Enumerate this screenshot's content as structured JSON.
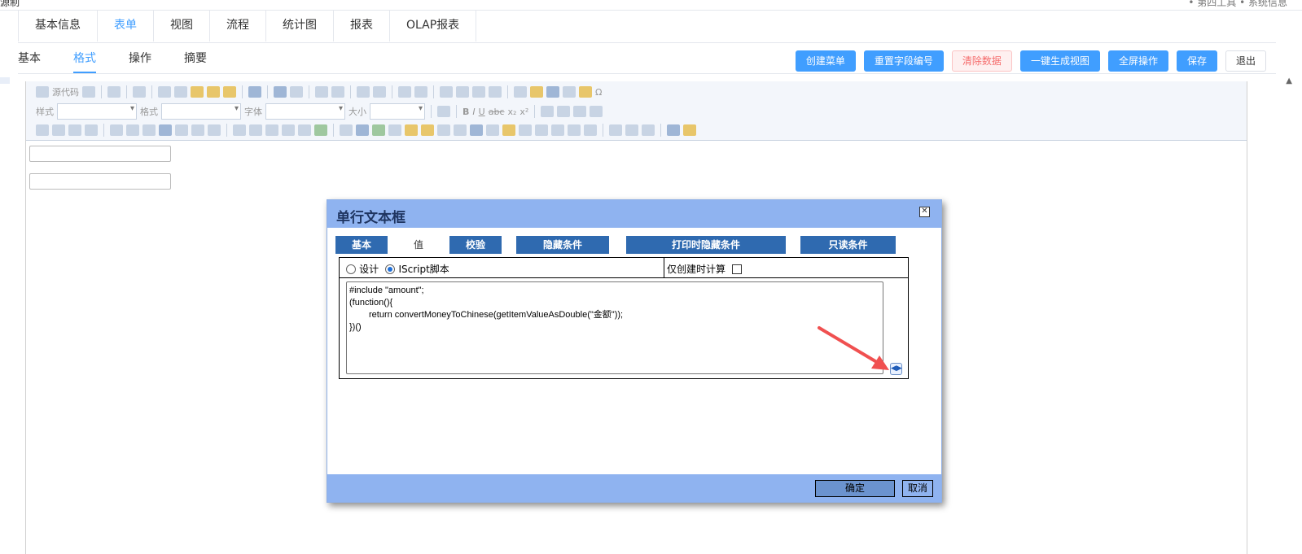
{
  "header": {
    "title_fragment": "源制",
    "right_fragment": "• 第四工具  • 系统信息"
  },
  "main_tabs": [
    {
      "label": "基本信息"
    },
    {
      "label": "表单"
    },
    {
      "label": "视图"
    },
    {
      "label": "流程"
    },
    {
      "label": "统计图"
    },
    {
      "label": "报表"
    },
    {
      "label": "OLAP报表"
    }
  ],
  "main_tab_active": "表单",
  "sub_tabs": [
    {
      "label": "基本"
    },
    {
      "label": "格式"
    },
    {
      "label": "操作"
    },
    {
      "label": "摘要"
    }
  ],
  "sub_tab_active": "格式",
  "actions": {
    "create_menu": "创建菜单",
    "reset_field_no": "重置字段编号",
    "clear_data": "清除数据",
    "gen_view": "一键生成视图",
    "fullscreen": "全屏操作",
    "save": "保存",
    "exit": "退出"
  },
  "toolbar": {
    "source": "源代码",
    "style": "样式",
    "format": "格式",
    "font": "字体",
    "size": "大小",
    "bold": "B",
    "italic": "I",
    "underline": "U",
    "strike": "abc",
    "subscript": "x₂",
    "superscript": "x²",
    "omega": "Ω"
  },
  "dialog": {
    "title": "单行文本框",
    "close": "✕",
    "tabs": [
      {
        "label": "基本"
      },
      {
        "label": "值"
      },
      {
        "label": "校验"
      },
      {
        "label": "隐藏条件"
      },
      {
        "label": "打印时隐藏条件"
      },
      {
        "label": "只读条件"
      }
    ],
    "active_tab": "值",
    "radio_design": "设计",
    "radio_iscript": "IScript脚本",
    "only_on_create": "仅创建时计算",
    "code_lines": [
      "#include \"amount\";",
      "(function(){",
      "return convertMoneyToChinese(getItemValueAsDouble(\"金额\"));",
      "})()"
    ],
    "ok": "确定",
    "cancel": "取消"
  },
  "colors": {
    "accent": "#409eff",
    "dialog_bar": "#8fb3f0",
    "dialog_tab": "#2f6ab0",
    "arrow": "#f05050"
  }
}
